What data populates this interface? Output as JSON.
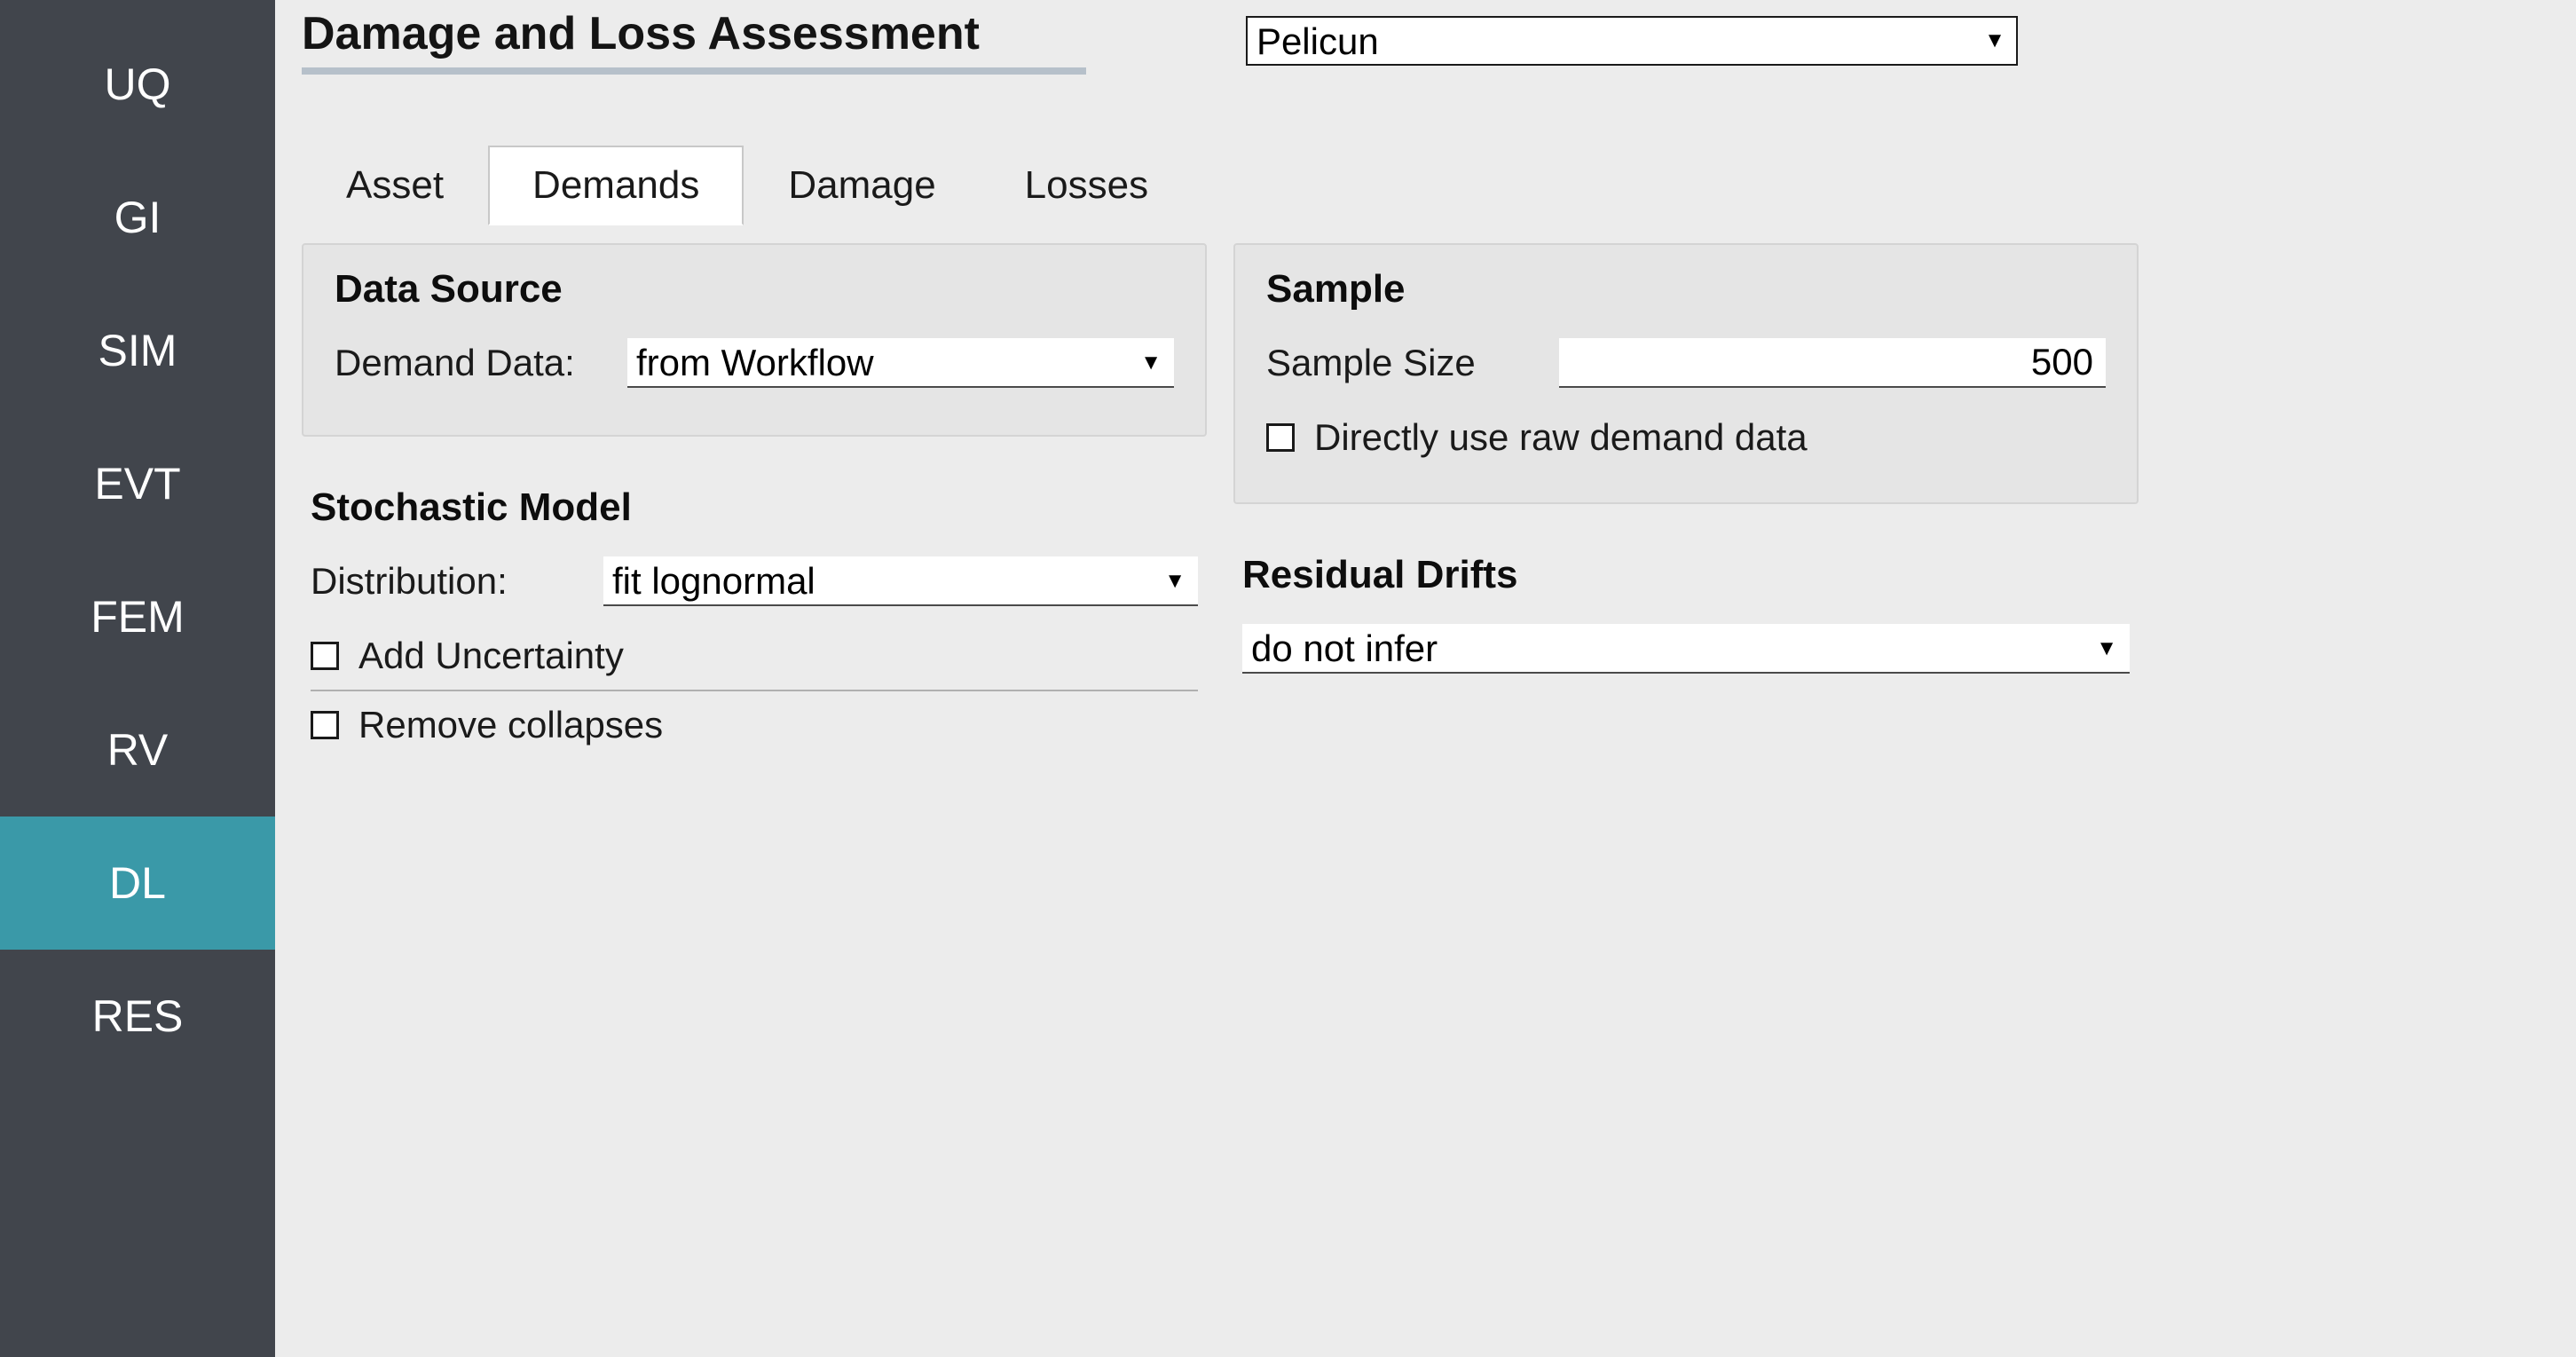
{
  "sidebar": {
    "items": [
      {
        "label": "UQ",
        "active": false
      },
      {
        "label": "GI",
        "active": false
      },
      {
        "label": "SIM",
        "active": false
      },
      {
        "label": "EVT",
        "active": false
      },
      {
        "label": "FEM",
        "active": false
      },
      {
        "label": "RV",
        "active": false
      },
      {
        "label": "DL",
        "active": true
      },
      {
        "label": "RES",
        "active": false
      }
    ]
  },
  "header": {
    "title": "Damage and Loss Assessment",
    "method_selected": "Pelicun"
  },
  "tabs": [
    {
      "label": "Asset",
      "active": false
    },
    {
      "label": "Demands",
      "active": true
    },
    {
      "label": "Damage",
      "active": false
    },
    {
      "label": "Losses",
      "active": false
    }
  ],
  "data_source": {
    "title": "Data Source",
    "demand_data_label": "Demand Data:",
    "demand_data_value": "from Workflow"
  },
  "stochastic": {
    "title": "Stochastic Model",
    "distribution_label": "Distribution:",
    "distribution_value": "fit lognormal",
    "add_uncertainty_label": "Add Uncertainty",
    "add_uncertainty_checked": false,
    "remove_collapses_label": "Remove collapses",
    "remove_collapses_checked": false
  },
  "sample": {
    "title": "Sample",
    "size_label": "Sample Size",
    "size_value": "500",
    "use_raw_label": "Directly use raw demand data",
    "use_raw_checked": false
  },
  "residual_drifts": {
    "title": "Residual Drifts",
    "value": "do not infer"
  }
}
